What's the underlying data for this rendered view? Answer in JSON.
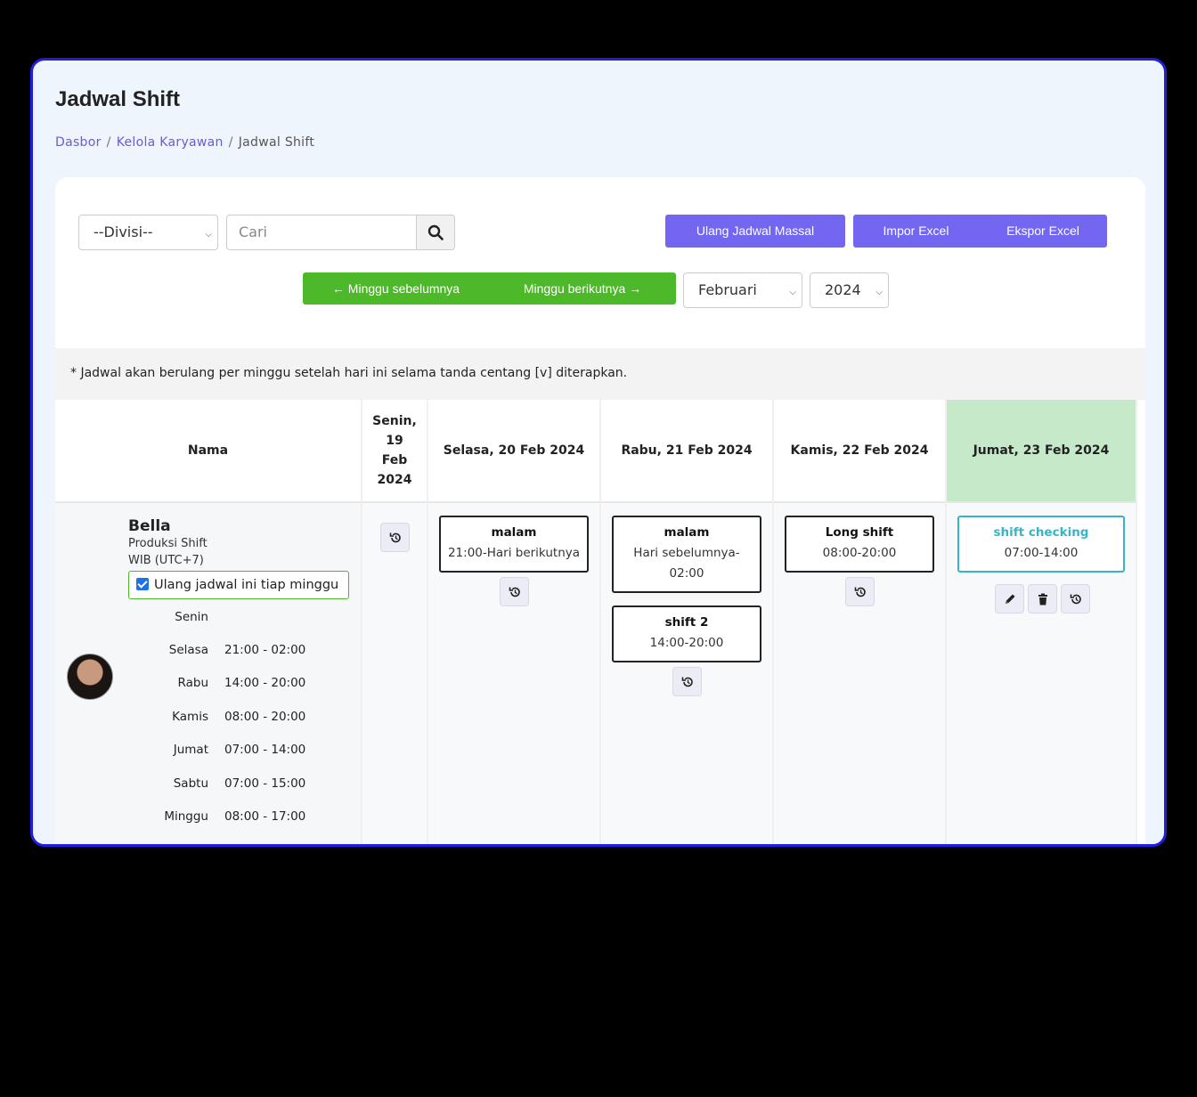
{
  "page_title": "Jadwal Shift",
  "breadcrumb": [
    "Dasbor",
    "Kelola Karyawan",
    "Jadwal Shift"
  ],
  "filters": {
    "division_select": "--Divisi--",
    "search_placeholder": "Cari",
    "month_select": "Februari",
    "year_select": "2024"
  },
  "buttons": {
    "mass_repeat": "Ulang Jadwal Massal",
    "import": "Impor Excel",
    "export": "Ekspor Excel",
    "prev_week": "← Minggu sebelumnya",
    "next_week": "Minggu berikutnya →"
  },
  "note": "* Jadwal akan berulang per minggu setelah hari ini selama tanda centang [v] diterapkan.",
  "columns": {
    "name": "Nama",
    "mon": "Senin, 19 Feb 2024",
    "tue": "Selasa, 20 Feb 2024",
    "wed": "Rabu, 21 Feb 2024",
    "thu": "Kamis, 22 Feb 2024",
    "fri": "Jumat, 23 Feb 2024"
  },
  "today_highlight_color": "#c6e9c9",
  "employee": {
    "name": "Bella",
    "division": "Produksi Shift",
    "timezone": "WIB (UTC+7)",
    "repeat_label": "Ulang jadwal ini tiap minggu",
    "repeat_checked": true,
    "weekly": [
      {
        "day": "Senin",
        "time": ""
      },
      {
        "day": "Selasa",
        "time": "21:00 - 02:00"
      },
      {
        "day": "Rabu",
        "time": "14:00 - 20:00"
      },
      {
        "day": "Kamis",
        "time": "08:00 - 20:00"
      },
      {
        "day": "Jumat",
        "time": "07:00 - 14:00"
      },
      {
        "day": "Sabtu",
        "time": "07:00 - 15:00"
      },
      {
        "day": "Minggu",
        "time": "08:00 - 17:00"
      }
    ]
  },
  "shifts": {
    "tue": [
      {
        "name": "malam",
        "time": "21:00-Hari berikutnya"
      }
    ],
    "wed": [
      {
        "name": "malam",
        "time": "Hari sebelumnya-02:00"
      },
      {
        "name": "shift 2",
        "time": "14:00-20:00"
      }
    ],
    "thu": [
      {
        "name": "Long shift",
        "time": "08:00-20:00"
      }
    ],
    "fri": [
      {
        "name": "shift checking",
        "time": "07:00-14:00"
      }
    ]
  },
  "colors": {
    "accent_purple": "#7366f0",
    "accent_green": "#4cb82a",
    "checking_teal": "#37b5c6"
  }
}
